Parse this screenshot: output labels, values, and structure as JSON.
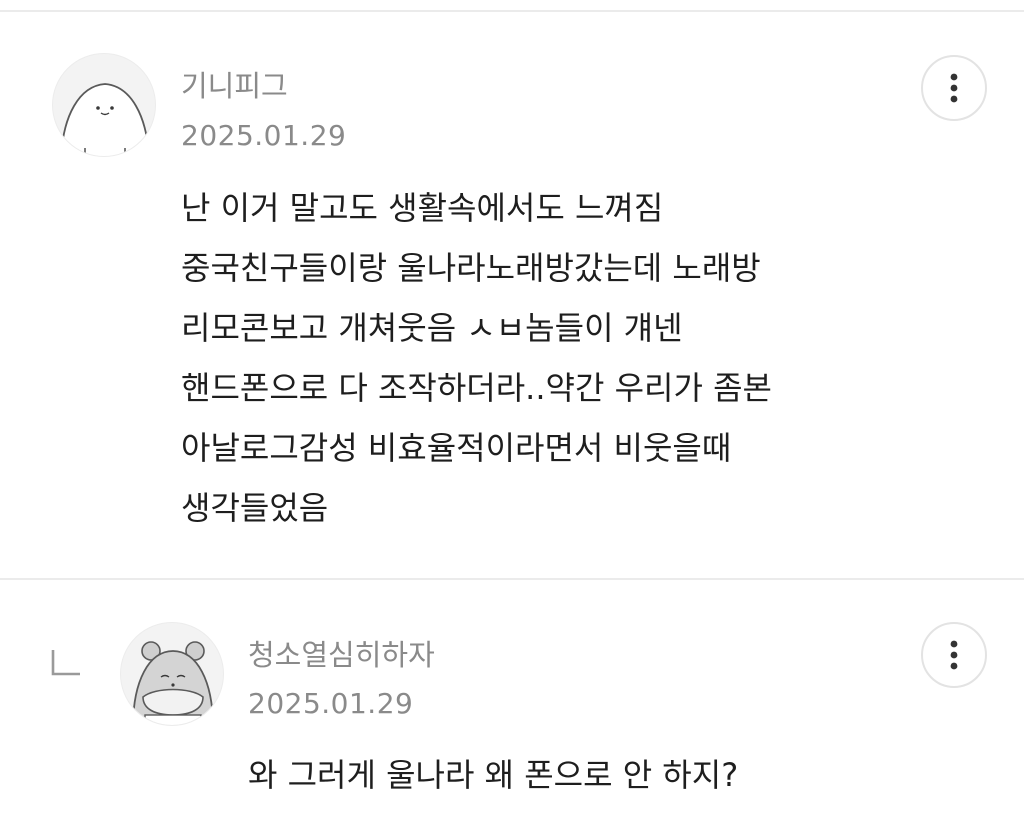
{
  "comments": [
    {
      "nickname": "기니피그",
      "date": "2025.01.29",
      "avatar_icon": "cat-face-avatar-icon",
      "more_icon": "more-vertical-icon",
      "lines": [
        "난 이거 말고도 생활속에서도 느껴짐",
        "중국친구들이랑 울나라노래방갔는데 노래방",
        "리모콘보고 개쳐웃음 ㅅㅂ놈들이 걔넨",
        "핸드폰으로 다 조작하더라..약간 우리가 좀본",
        "아날로그감성 비효율적이라면서 비웃을때",
        "생각들었음"
      ]
    },
    {
      "nickname": "청소열심히하자",
      "date": "2025.01.29",
      "avatar_icon": "hamster-avatar-icon",
      "more_icon": "more-vertical-icon",
      "reply_icon": "reply-arrow-icon",
      "lines": [
        "와 그러게 울나라 왜 폰으로 안 하지?"
      ]
    }
  ],
  "colors": {
    "meta_text": "#8a8a8a",
    "body_text": "#1e1e1e",
    "divider": "#ebebeb",
    "button_border": "#e3e3e3"
  }
}
